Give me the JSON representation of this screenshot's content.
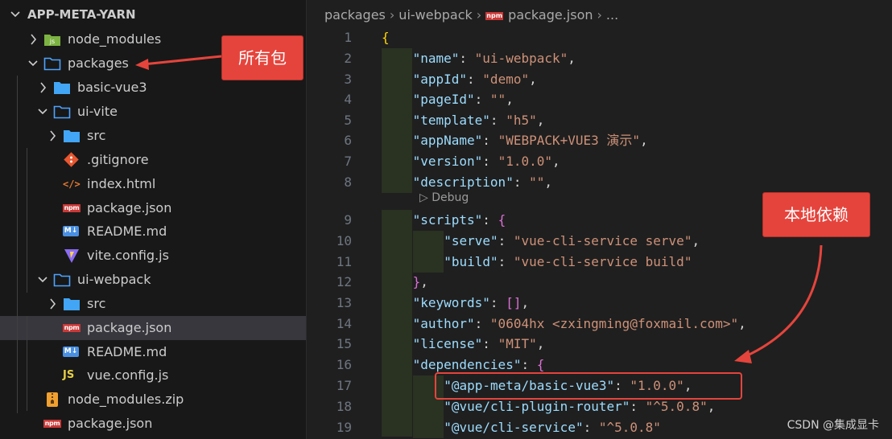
{
  "explorer": {
    "root": "APP-META-YARN",
    "items": [
      {
        "label": "node_modules",
        "icon": "folder-node-icon",
        "chevron": "right"
      },
      {
        "label": "packages",
        "icon": "folder-icon",
        "chevron": "down"
      },
      {
        "label": "basic-vue3",
        "icon": "folder-filled-icon",
        "chevron": "right"
      },
      {
        "label": "ui-vite",
        "icon": "folder-open-icon",
        "chevron": "down"
      },
      {
        "label": "src",
        "icon": "folder-filled-icon",
        "chevron": "right"
      },
      {
        "label": ".gitignore",
        "icon": "git-icon",
        "chevron": ""
      },
      {
        "label": "index.html",
        "icon": "html-icon",
        "chevron": ""
      },
      {
        "label": "package.json",
        "icon": "npm-icon",
        "chevron": ""
      },
      {
        "label": "README.md",
        "icon": "markdown-icon",
        "chevron": ""
      },
      {
        "label": "vite.config.js",
        "icon": "vite-icon",
        "chevron": ""
      },
      {
        "label": "ui-webpack",
        "icon": "folder-open-icon",
        "chevron": "down"
      },
      {
        "label": "src",
        "icon": "folder-filled-icon",
        "chevron": "right"
      },
      {
        "label": "package.json",
        "icon": "npm-icon",
        "chevron": "",
        "selected": true
      },
      {
        "label": "README.md",
        "icon": "markdown-icon",
        "chevron": ""
      },
      {
        "label": "vue.config.js",
        "icon": "js-icon",
        "chevron": ""
      },
      {
        "label": "node_modules.zip",
        "icon": "zip-icon",
        "chevron": ""
      },
      {
        "label": "package.json",
        "icon": "npm-icon",
        "chevron": ""
      }
    ]
  },
  "breadcrumb": {
    "parts": [
      "packages",
      "ui-webpack",
      "package.json",
      "..."
    ],
    "file_badge": "npm"
  },
  "editor": {
    "lines": [
      {
        "n": "1",
        "segs": [
          [
            "b1",
            "{"
          ]
        ]
      },
      {
        "n": "2",
        "segs": [
          [
            "k",
            "\"name\""
          ],
          [
            "p",
            ": "
          ],
          [
            "s",
            "\"ui-webpack\""
          ],
          [
            "p",
            ","
          ]
        ]
      },
      {
        "n": "3",
        "segs": [
          [
            "k",
            "\"appId\""
          ],
          [
            "p",
            ": "
          ],
          [
            "s",
            "\"demo\""
          ],
          [
            "p",
            ","
          ]
        ]
      },
      {
        "n": "4",
        "segs": [
          [
            "k",
            "\"pageId\""
          ],
          [
            "p",
            ": "
          ],
          [
            "s",
            "\"\""
          ],
          [
            "p",
            ","
          ]
        ]
      },
      {
        "n": "5",
        "segs": [
          [
            "k",
            "\"template\""
          ],
          [
            "p",
            ": "
          ],
          [
            "s",
            "\"h5\""
          ],
          [
            "p",
            ","
          ]
        ]
      },
      {
        "n": "6",
        "segs": [
          [
            "k",
            "\"appName\""
          ],
          [
            "p",
            ": "
          ],
          [
            "s",
            "\"WEBPACK+VUE3 演示\""
          ],
          [
            "p",
            ","
          ]
        ]
      },
      {
        "n": "7",
        "segs": [
          [
            "k",
            "\"version\""
          ],
          [
            "p",
            ": "
          ],
          [
            "s",
            "\"1.0.0\""
          ],
          [
            "p",
            ","
          ]
        ]
      },
      {
        "n": "8",
        "segs": [
          [
            "k",
            "\"description\""
          ],
          [
            "p",
            ": "
          ],
          [
            "s",
            "\"\""
          ],
          [
            "p",
            ","
          ]
        ]
      },
      {
        "n": "9",
        "segs": [
          [
            "k",
            "\"scripts\""
          ],
          [
            "p",
            ": "
          ],
          [
            "b2",
            "{"
          ]
        ]
      },
      {
        "n": "10",
        "segs": [
          [
            "k",
            "\"serve\""
          ],
          [
            "p",
            ": "
          ],
          [
            "s",
            "\"vue-cli-service serve\""
          ],
          [
            "p",
            ","
          ]
        ]
      },
      {
        "n": "11",
        "segs": [
          [
            "k",
            "\"build\""
          ],
          [
            "p",
            ": "
          ],
          [
            "s",
            "\"vue-cli-service build\""
          ]
        ]
      },
      {
        "n": "12",
        "segs": [
          [
            "b2",
            "}"
          ],
          [
            "p",
            ","
          ]
        ]
      },
      {
        "n": "13",
        "segs": [
          [
            "k",
            "\"keywords\""
          ],
          [
            "p",
            ": "
          ],
          [
            "b2",
            "[]"
          ],
          [
            "p",
            ","
          ]
        ]
      },
      {
        "n": "14",
        "segs": [
          [
            "k",
            "\"author\""
          ],
          [
            "p",
            ": "
          ],
          [
            "s",
            "\"0604hx <zxingming@foxmail.com>\""
          ],
          [
            "p",
            ","
          ]
        ]
      },
      {
        "n": "15",
        "segs": [
          [
            "k",
            "\"license\""
          ],
          [
            "p",
            ": "
          ],
          [
            "s",
            "\"MIT\""
          ],
          [
            "p",
            ","
          ]
        ]
      },
      {
        "n": "16",
        "segs": [
          [
            "k",
            "\"dependencies\""
          ],
          [
            "p",
            ": "
          ],
          [
            "b2",
            "{"
          ]
        ]
      },
      {
        "n": "17",
        "segs": [
          [
            "k",
            "\"@app-meta/basic-vue3\""
          ],
          [
            "p",
            ": "
          ],
          [
            "s",
            "\"1.0.0\""
          ],
          [
            "p",
            ","
          ]
        ]
      },
      {
        "n": "18",
        "segs": [
          [
            "k",
            "\"@vue/cli-plugin-router\""
          ],
          [
            "p",
            ": "
          ],
          [
            "s",
            "\"^5.0.8\""
          ],
          [
            "p",
            ","
          ]
        ]
      },
      {
        "n": "19",
        "segs": [
          [
            "k",
            "\"@vue/cli-service\""
          ],
          [
            "p",
            ": "
          ],
          [
            "s",
            "\"^5.0.8\""
          ]
        ]
      }
    ],
    "codelens": "Debug"
  },
  "annotations": {
    "packages_callout": "所有包",
    "local_dep_callout": "本地依赖"
  },
  "watermark": "CSDN @集成显卡",
  "colors": {
    "annotation_red": "#e5443c",
    "selected_row": "#37373d",
    "editor_bg": "#1f1f1f"
  }
}
